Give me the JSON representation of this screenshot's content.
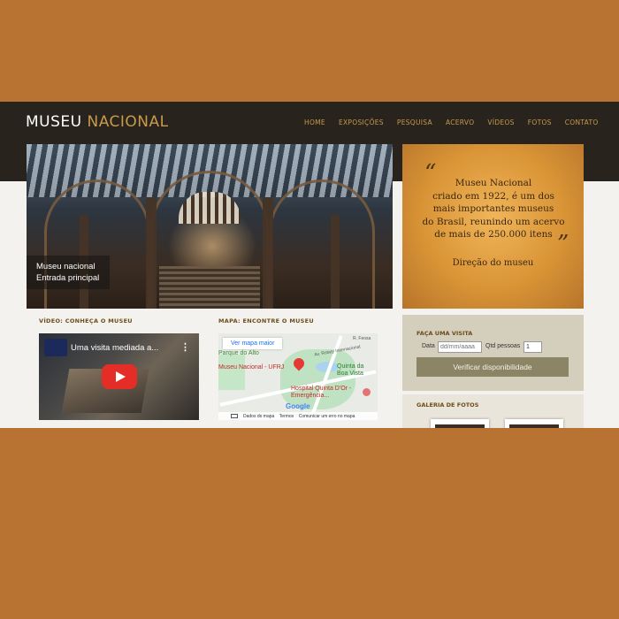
{
  "header": {
    "logo_main": "MUSEU",
    "logo_accent": "NACIONAL",
    "nav": [
      "HOME",
      "EXPOSIÇÕES",
      "PESQUISA",
      "ACERVO",
      "VÍDEOS",
      "FOTOS",
      "CONTATO"
    ]
  },
  "hero": {
    "caption_line1": "Museu nacional",
    "caption_line2": "Entrada principal"
  },
  "quote": {
    "open_mark": "“",
    "close_mark": "”",
    "text_lines": [
      "Museu Nacional",
      "criado em 1922, é um dos",
      "mais importantes museus",
      "do Brasil, reunindo um acervo",
      "de mais de 250.000 itens"
    ],
    "author": "Direção do museu"
  },
  "video_section": {
    "title": "VÍDEO: CONHEÇA O MUSEU",
    "video_title": "Uma visita mediada a...",
    "menu_glyph": "⋮"
  },
  "map_section": {
    "title": "MAPA: ENCONTRE O MUSEU",
    "view_larger": "Ver mapa maior",
    "labels": {
      "parque": "Parque do Alto",
      "museu": "Museu Nacional - UFRJ",
      "quinta": "Quinta da Boa Vista",
      "hospital": "Hospital Quinta D'Or - Emergência...",
      "road1": "R. Feosa",
      "road2": "Av. Rotary Internacional",
      "google": "Google"
    },
    "footer": [
      "Dados do mapa",
      "Termos",
      "Comunicar um erro no mapa"
    ]
  },
  "visit": {
    "title": "FAÇA UMA VISITA",
    "date_label": "Data",
    "date_placeholder": "dd/mm/aaaa",
    "people_label": "Qtd pessoas",
    "people_value": "1",
    "check_button": "Verificar disponibilidade"
  },
  "gallery": {
    "title": "GALERIA DE FOTOS"
  },
  "colors": {
    "background": "#b87333",
    "header": "#28241d",
    "accent": "#c89a4a",
    "page": "#f3f2ee"
  }
}
